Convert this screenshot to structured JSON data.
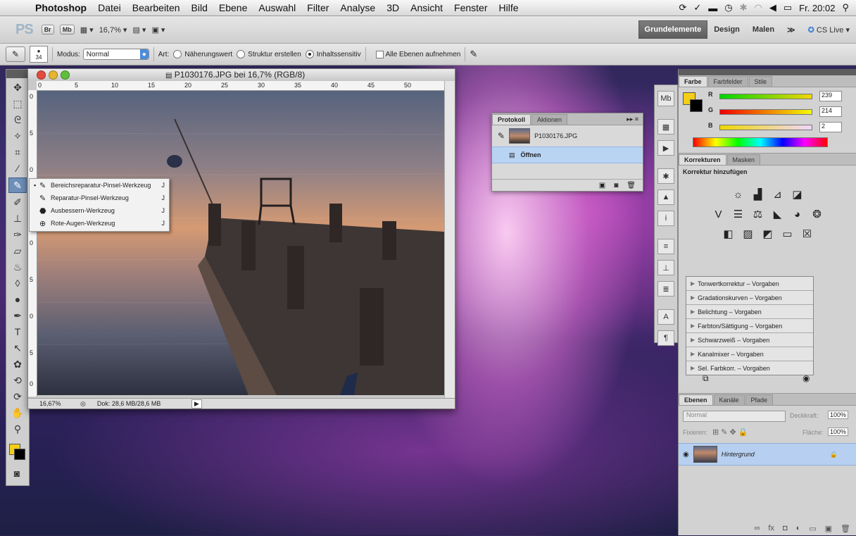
{
  "menubar": {
    "apple": "",
    "app": "Photoshop",
    "items": [
      "Datei",
      "Bearbeiten",
      "Bild",
      "Ebene",
      "Auswahl",
      "Filter",
      "Analyse",
      "3D",
      "Ansicht",
      "Fenster",
      "Hilfe"
    ],
    "clock": "Fr. 20:02"
  },
  "appbar": {
    "logo": "PS",
    "br": "Br",
    "mb": "Mb",
    "zoom": "16,7% ▾",
    "workspaces": [
      "Grundelemente",
      "Design",
      "Malen"
    ],
    "more": "≫",
    "cslive": "CS Live"
  },
  "options": {
    "brush_size": "34",
    "modus_label": "Modus:",
    "modus_value": "Normal",
    "art_label": "Art:",
    "radio1": "Näherungswert",
    "radio2": "Struktur erstellen",
    "radio3": "Inhaltssensitiv",
    "check1": "Alle Ebenen aufnehmen"
  },
  "flyout": {
    "items": [
      {
        "label": "Bereichsreparatur-Pinsel-Werkzeug",
        "key": "J"
      },
      {
        "label": "Reparatur-Pinsel-Werkzeug",
        "key": "J"
      },
      {
        "label": "Ausbessern-Werkzeug",
        "key": "J"
      },
      {
        "label": "Rote-Augen-Werkzeug",
        "key": "J"
      }
    ]
  },
  "document": {
    "title": "P1030176.JPG bei 16,7% (RGB/8)",
    "zoom": "16,67%",
    "doc_info": "Dok: 28,6 MB/28,6 MB",
    "ruler_h": [
      "0",
      "5",
      "10",
      "15",
      "20",
      "25",
      "30",
      "35",
      "40",
      "45",
      "50"
    ],
    "ruler_v": [
      "0",
      "5",
      "0",
      "5",
      "0",
      "5",
      "0",
      "5",
      "0"
    ]
  },
  "history": {
    "tabs": [
      "Protokoll",
      "Aktionen"
    ],
    "snapshot": "P1030176.JPG",
    "step": "Öffnen"
  },
  "color_panel": {
    "tabs": [
      "Farbe",
      "Farbfelder",
      "Stile"
    ],
    "r_label": "R",
    "r_value": "239",
    "g_label": "G",
    "g_value": "214",
    "b_label": "B",
    "b_value": "2"
  },
  "adjust_panel": {
    "tabs": [
      "Korrekturen",
      "Masken"
    ],
    "heading": "Korrektur hinzufügen",
    "presets": [
      "Tonwertkorrektur – Vorgaben",
      "Gradationskurven – Vorgaben",
      "Belichtung – Vorgaben",
      "Farbton/Sättigung – Vorgaben",
      "Schwarzweiß – Vorgaben",
      "Kanalmixer – Vorgaben",
      "Sel. Farbkorr. – Vorgaben"
    ]
  },
  "layers_panel": {
    "tabs": [
      "Ebenen",
      "Kanäle",
      "Pfade"
    ],
    "blend": "Normal",
    "opacity_label": "Deckkraft:",
    "opacity": "100%",
    "lock_label": "Fixieren:",
    "fill_label": "Fläche:",
    "fill": "100%",
    "layer_name": "Hintergrund"
  },
  "colors": {
    "foreground": "#f3cd18",
    "background": "#000000",
    "accent": "#b9d3f3"
  }
}
